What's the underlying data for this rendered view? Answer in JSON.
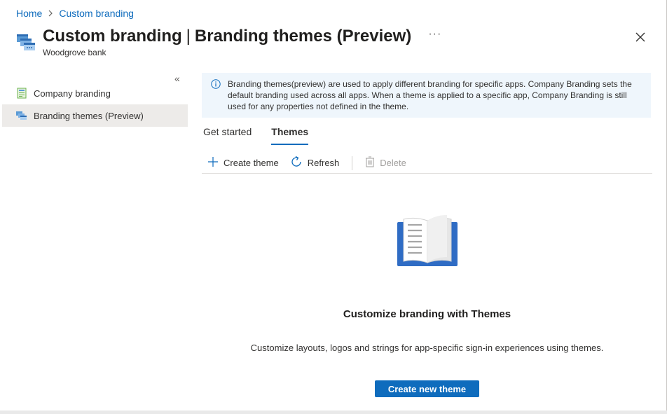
{
  "breadcrumb": {
    "home": "Home",
    "current": "Custom branding"
  },
  "header": {
    "title_bold": "Custom branding",
    "pipe": "|",
    "title_rest": "Branding themes (Preview)",
    "subtitle": "Woodgrove bank",
    "more_label": "···"
  },
  "sidebar": {
    "collapse_label": "«",
    "items": [
      {
        "label": "Company branding",
        "icon": "company-branding-icon",
        "active": false
      },
      {
        "label": "Branding themes (Preview)",
        "icon": "branding-themes-icon",
        "active": true
      }
    ]
  },
  "info": {
    "text": "Branding themes(preview) are used to apply different branding for specific apps. Company Branding sets the default branding used across all apps. When a theme is applied to a specific app, Company Branding is still used for any properties not defined in the theme."
  },
  "tabs": [
    {
      "label": "Get started",
      "active": false
    },
    {
      "label": "Themes",
      "active": true
    }
  ],
  "toolbar": {
    "create_label": "Create theme",
    "refresh_label": "Refresh",
    "delete_label": "Delete"
  },
  "empty_state": {
    "title": "Customize branding with Themes",
    "description": "Customize layouts, logos and strings for app-specific sign-in experiences using themes.",
    "button_label": "Create new theme"
  },
  "colors": {
    "accent": "#0f6cbd",
    "info_bg": "#eff6fc",
    "active_nav": "#edebe9"
  }
}
